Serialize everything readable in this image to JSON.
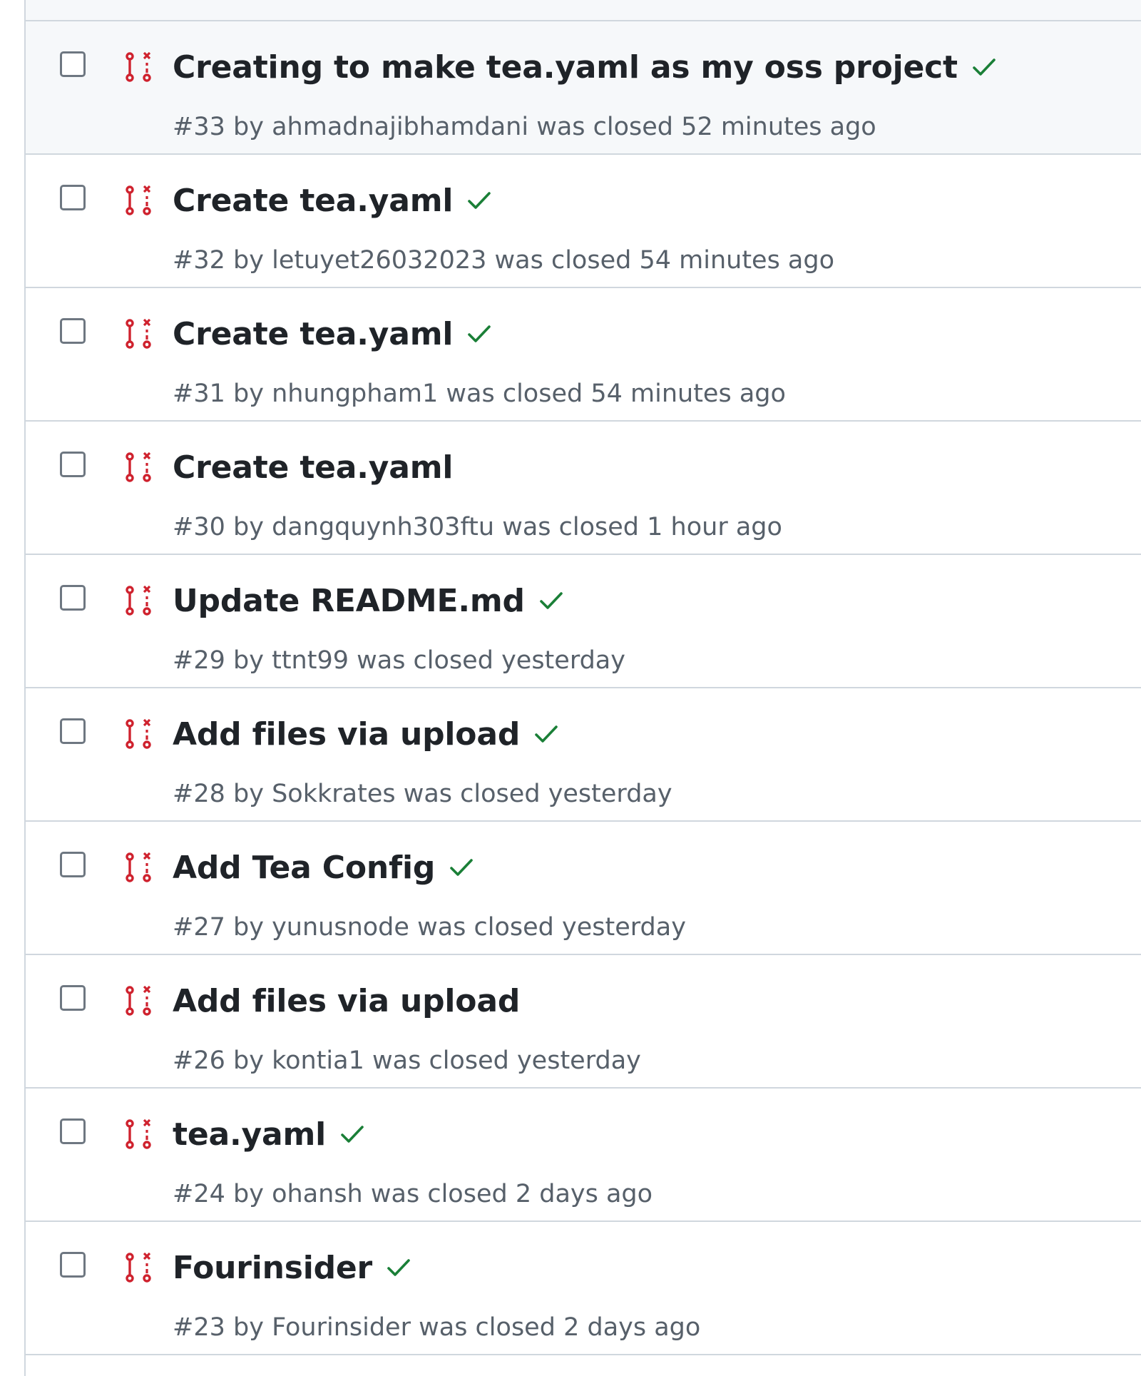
{
  "pull_requests": [
    {
      "title": "Creating to make tea.yaml as my oss project",
      "number": "#33",
      "by": "by",
      "author": "ahmadnajibhamdani",
      "closed_text": "was closed",
      "time": "52 minutes ago",
      "checks_passed": true,
      "hover": true
    },
    {
      "title": "Create tea.yaml",
      "number": "#32",
      "by": "by",
      "author": "letuyet26032023",
      "closed_text": "was closed",
      "time": "54 minutes ago",
      "checks_passed": true,
      "hover": false
    },
    {
      "title": "Create tea.yaml",
      "number": "#31",
      "by": "by",
      "author": "nhungpham1",
      "closed_text": "was closed",
      "time": "54 minutes ago",
      "checks_passed": true,
      "hover": false
    },
    {
      "title": "Create tea.yaml",
      "number": "#30",
      "by": "by",
      "author": "dangquynh303ftu",
      "closed_text": "was closed",
      "time": "1 hour ago",
      "checks_passed": false,
      "hover": false
    },
    {
      "title": "Update README.md",
      "number": "#29",
      "by": "by",
      "author": "ttnt99",
      "closed_text": "was closed",
      "time": "yesterday",
      "checks_passed": true,
      "hover": false
    },
    {
      "title": "Add files via upload",
      "number": "#28",
      "by": "by",
      "author": "Sokkrates",
      "closed_text": "was closed",
      "time": "yesterday",
      "checks_passed": true,
      "hover": false
    },
    {
      "title": "Add Tea Config",
      "number": "#27",
      "by": "by",
      "author": "yunusnode",
      "closed_text": "was closed",
      "time": "yesterday",
      "checks_passed": true,
      "hover": false
    },
    {
      "title": "Add files via upload",
      "number": "#26",
      "by": "by",
      "author": "kontia1",
      "closed_text": "was closed",
      "time": "yesterday",
      "checks_passed": false,
      "hover": false
    },
    {
      "title": "tea.yaml",
      "number": "#24",
      "by": "by",
      "author": "ohansh",
      "closed_text": "was closed",
      "time": "2 days ago",
      "checks_passed": true,
      "hover": false
    },
    {
      "title": "Fourinsider",
      "number": "#23",
      "by": "by",
      "author": "Fourinsider",
      "closed_text": "was closed",
      "time": "2 days ago",
      "checks_passed": true,
      "hover": false
    }
  ],
  "colors": {
    "closed_pr_icon": "#cf222e",
    "check_success": "#1a7f37",
    "title_text": "#1f2328",
    "meta_text": "#57606a",
    "border": "#d0d7de",
    "hover_bg": "#f6f8fa"
  },
  "icons": {
    "pr_state": "git-pull-request-closed-icon",
    "checks": "check-icon"
  }
}
